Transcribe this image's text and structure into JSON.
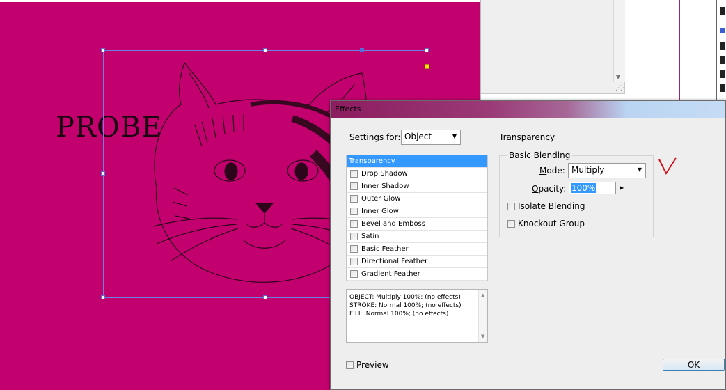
{
  "canvas": {
    "bg": "#c2006e",
    "text": "PROBE"
  },
  "dialog": {
    "title": "Effects",
    "settings_label": "Settings for:",
    "settings_value": "Object",
    "effects": [
      {
        "label": "Transparency"
      },
      {
        "label": "Drop Shadow"
      },
      {
        "label": "Inner Shadow"
      },
      {
        "label": "Outer Glow"
      },
      {
        "label": "Inner Glow"
      },
      {
        "label": "Bevel and Emboss"
      },
      {
        "label": "Satin"
      },
      {
        "label": "Basic Feather"
      },
      {
        "label": "Directional Feather"
      },
      {
        "label": "Gradient Feather"
      }
    ],
    "summary_lines": [
      "OBJECT: Multiply 100%; (no effects)",
      "STROKE: Normal 100%; (no effects)",
      "FILL: Normal 100%; (no effects)"
    ],
    "preview_label": "Preview",
    "ok_label": "OK",
    "section_title": "Transparency",
    "group_title": "Basic Blending",
    "mode_label": "Mode:",
    "mode_value": "Multiply",
    "opacity_label": "Opacity:",
    "opacity_value": "100%",
    "isolate_label": "Isolate Blending",
    "knockout_label": "Knockout Group"
  },
  "colors": {
    "selection": "#3399ff",
    "accent": "#c2006e"
  }
}
